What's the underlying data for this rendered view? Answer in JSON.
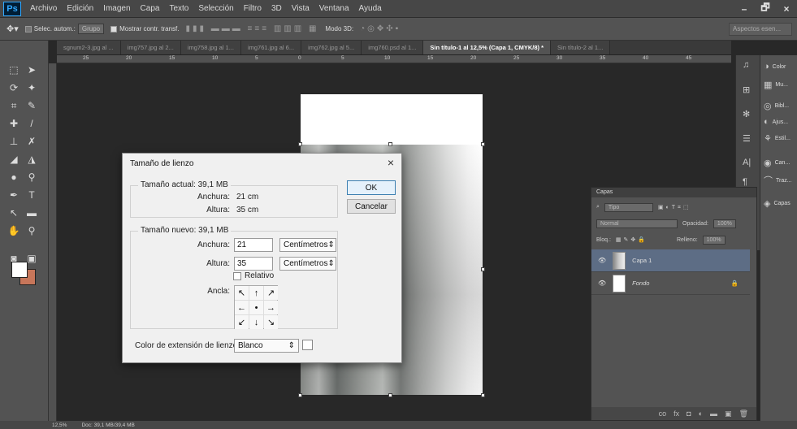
{
  "app": {
    "logo": "Ps"
  },
  "menu": [
    "Archivo",
    "Edición",
    "Imagen",
    "Capa",
    "Texto",
    "Selección",
    "Filtro",
    "3D",
    "Vista",
    "Ventana",
    "Ayuda"
  ],
  "window_controls": {
    "minimize": "–",
    "restore": "🗗",
    "close": "×"
  },
  "options": {
    "auto_select": "Selec. autom.:",
    "auto_select_value": "Grupo",
    "show_transform": "Mostrar contr. transf.",
    "mode3d": "Modo 3D:",
    "workspace": "Aspectos esen..."
  },
  "tabs": [
    "sgnum2-3.jpg al ...",
    "img757.jpg al 2...",
    "img758.jpg al 1...",
    "img761.jpg al 6...",
    "img762.jpg al 5...",
    "img760.psd al 1...",
    "Sin título-1 al 12,5% (Capa 1, CMYK/8) *",
    "Sin título-2 al 1..."
  ],
  "ruler_h": [
    "25",
    "20",
    "15",
    "10",
    "5",
    "0",
    "5",
    "10",
    "15",
    "20",
    "25",
    "30",
    "35",
    "40",
    "45"
  ],
  "status": {
    "zoom": "12,5%",
    "doc": "Doc: 39,1 MB/39,4 MB"
  },
  "dialog": {
    "title": "Tamaño de lienzo",
    "close": "×",
    "current_group": "Tamaño actual: 39,1 MB",
    "width_label": "Anchura:",
    "width_value": "21 cm",
    "height_label": "Altura:",
    "height_value": "35 cm",
    "new_group": "Tamaño nuevo: 39,1 MB",
    "new_width_label": "Anchura:",
    "new_width": "21",
    "new_width_unit": "Centímetros",
    "new_height_label": "Altura:",
    "new_height": "35",
    "new_height_unit": "Centímetros",
    "relative": "Relativo",
    "anchor_label": "Ancla:",
    "anchor_arrows": [
      "↖",
      "↑",
      "↗",
      "←",
      "•",
      "→",
      "↙",
      "↓",
      "↘"
    ],
    "ext_color_label": "Color de extensión de lienzo:",
    "ext_color": "Blanco",
    "ok": "OK",
    "cancel": "Cancelar"
  },
  "layers": {
    "title": "Capas",
    "kind": "Tipo",
    "blend": "Normal",
    "opacity_label": "Opacidad:",
    "opacity": "100%",
    "lock_label": "Bloq.:",
    "fill_label": "Relleno:",
    "fill": "100%",
    "items": [
      {
        "name": "Capa 1"
      },
      {
        "name": "Fondo"
      }
    ],
    "foot_icons": [
      "co",
      "fx",
      "◘",
      "◐",
      "▬",
      "▣",
      "🗑"
    ]
  },
  "right_panels": [
    "Color",
    "Mu...",
    "Bibl...",
    "Ajus...",
    "Estil...",
    "Can...",
    "Traz...",
    "Capas"
  ]
}
